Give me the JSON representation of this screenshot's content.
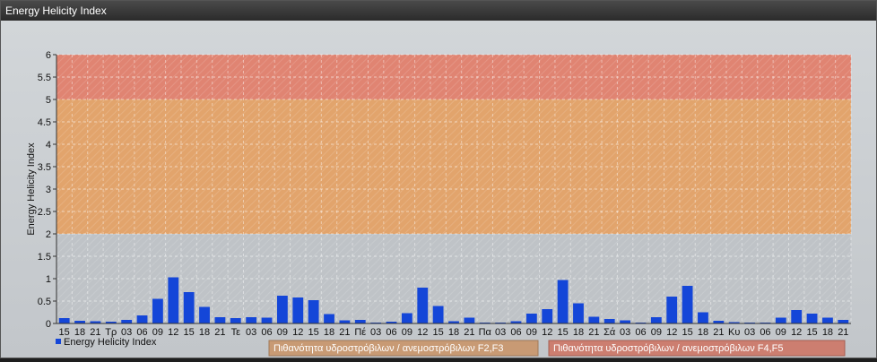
{
  "window": {
    "title": "Energy Helicity Index"
  },
  "chart_data": {
    "type": "bar",
    "ylabel": "Energy Helicity Index",
    "ylim": [
      0,
      6
    ],
    "yticks": [
      "0",
      "0.5",
      "1",
      "1.5",
      "2",
      "2.5",
      "3",
      "3.5",
      "4",
      "4.5",
      "5",
      "5.5",
      "6"
    ],
    "grid": true,
    "categories": [
      "15",
      "18",
      "21",
      "Τρ",
      "03",
      "06",
      "09",
      "12",
      "15",
      "18",
      "21",
      "Τε",
      "03",
      "06",
      "09",
      "12",
      "15",
      "18",
      "21",
      "Πέ",
      "03",
      "06",
      "09",
      "12",
      "15",
      "18",
      "21",
      "Πα",
      "03",
      "06",
      "09",
      "12",
      "15",
      "18",
      "21",
      "Σά",
      "03",
      "06",
      "09",
      "12",
      "15",
      "18",
      "21",
      "Κυ",
      "03",
      "06",
      "09",
      "12",
      "15",
      "18",
      "21"
    ],
    "values": [
      0.12,
      0.06,
      0.05,
      0.04,
      0.08,
      0.18,
      0.55,
      1.03,
      0.7,
      0.37,
      0.14,
      0.12,
      0.14,
      0.13,
      0.62,
      0.58,
      0.52,
      0.21,
      0.07,
      0.08,
      0.02,
      0.04,
      0.23,
      0.8,
      0.39,
      0.05,
      0.13,
      0.02,
      0.02,
      0.05,
      0.22,
      0.32,
      0.97,
      0.45,
      0.15,
      0.1,
      0.07,
      0.02,
      0.14,
      0.6,
      0.84,
      0.25,
      0.06,
      0.03,
      0.02,
      0.02,
      0.13,
      0.3,
      0.22,
      0.13,
      0.08
    ],
    "bar_color": "#1446d8",
    "bands": [
      {
        "from": 0,
        "to": 2,
        "color": "#bfc3c7"
      },
      {
        "from": 2,
        "to": 5,
        "color": "#e2a46c"
      },
      {
        "from": 5,
        "to": 6,
        "color": "#e08472"
      }
    ],
    "legend": {
      "position": "bottom-left",
      "series_label": "Energy Helicity Index",
      "band_labels": [
        {
          "text": "Πιθανότητα υδροστρόβιλων / ανεμοστρόβιλων F2,F3",
          "color": "#c89a74"
        },
        {
          "text": "Πιθανότητα υδροστρόβιλων / ανεμοστρόβιλων F4,F5",
          "color": "#cc7e70"
        }
      ]
    }
  }
}
